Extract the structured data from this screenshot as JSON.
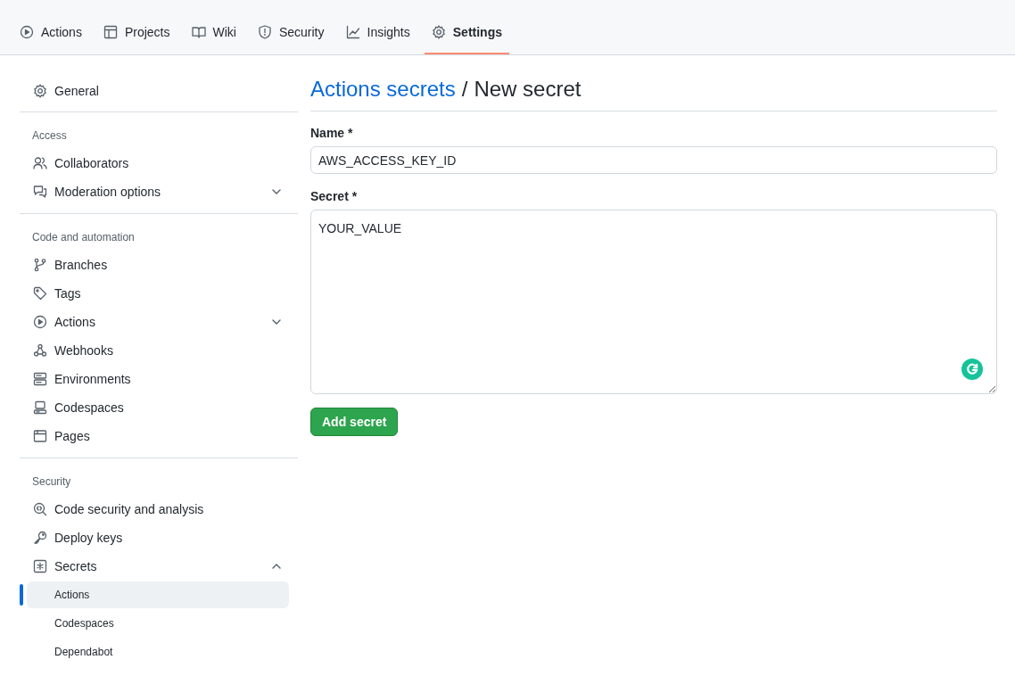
{
  "tabs": [
    {
      "label": "Actions",
      "kind": "play",
      "selected": false
    },
    {
      "label": "Projects",
      "kind": "table",
      "selected": false
    },
    {
      "label": "Wiki",
      "kind": "book",
      "selected": false
    },
    {
      "label": "Security",
      "kind": "shield",
      "selected": false
    },
    {
      "label": "Insights",
      "kind": "graph",
      "selected": false
    },
    {
      "label": "Settings",
      "kind": "gear",
      "selected": true
    }
  ],
  "sidebar": {
    "groups": [
      {
        "items": [
          {
            "label": "General",
            "kind": "gear"
          }
        ]
      },
      {
        "heading": "Access",
        "items": [
          {
            "label": "Collaborators",
            "kind": "people"
          },
          {
            "label": "Moderation options",
            "kind": "comments",
            "expanded": false
          }
        ]
      },
      {
        "heading": "Code and automation",
        "items": [
          {
            "label": "Branches",
            "kind": "branch"
          },
          {
            "label": "Tags",
            "kind": "tag"
          },
          {
            "label": "Actions",
            "kind": "play",
            "expanded": false
          },
          {
            "label": "Webhooks",
            "kind": "webhook"
          },
          {
            "label": "Environments",
            "kind": "server"
          },
          {
            "label": "Codespaces",
            "kind": "codespaces"
          },
          {
            "label": "Pages",
            "kind": "browser"
          }
        ]
      },
      {
        "heading": "Security",
        "items": [
          {
            "label": "Code security and analysis",
            "kind": "codescan"
          },
          {
            "label": "Deploy keys",
            "kind": "key"
          },
          {
            "label": "Secrets",
            "kind": "asterisk",
            "expanded": true,
            "children": [
              {
                "label": "Actions",
                "selected": true
              },
              {
                "label": "Codespaces",
                "selected": false
              },
              {
                "label": "Dependabot",
                "selected": false
              }
            ]
          }
        ]
      }
    ]
  },
  "header": {
    "link": "Actions secrets",
    "separator": "/",
    "title": "New secret"
  },
  "form": {
    "name_label": "Name *",
    "name_value": "AWS_ACCESS_KEY_ID",
    "secret_label": "Secret *",
    "secret_value": "YOUR_VALUE",
    "submit": "Add secret"
  }
}
